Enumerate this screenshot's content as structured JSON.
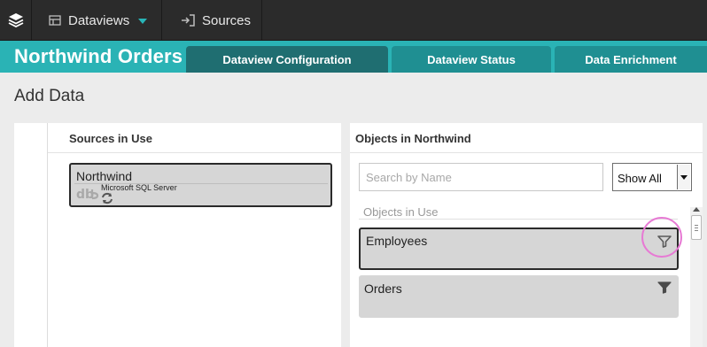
{
  "nav": {
    "logo_icon": "stack-layers-icon",
    "dataviews_label": "Dataviews",
    "dataviews_icon": "dataviews-icon",
    "sources_label": "Sources",
    "sources_icon": "sign-in-icon"
  },
  "header": {
    "title": "Northwind Orders",
    "tabs": [
      {
        "label": "Dataview Configuration",
        "active": true
      },
      {
        "label": "Dataview Status",
        "active": false
      },
      {
        "label": "Data Enrichment",
        "active": false
      }
    ]
  },
  "page": {
    "title": "Add Data"
  },
  "sources_panel": {
    "heading": "Sources in Use",
    "sources": [
      {
        "name": "Northwind",
        "type": "Microsoft SQL Server",
        "icon": "database-icon"
      }
    ]
  },
  "objects_panel": {
    "heading": "Objects in Northwind",
    "search": {
      "placeholder": "Search by Name",
      "value": ""
    },
    "filter_select": {
      "value": "Show All"
    },
    "section_label": "Objects in Use",
    "items": [
      {
        "label": "Employees",
        "selected": true,
        "filter_icon": "filter-outline-icon"
      },
      {
        "label": "Orders",
        "selected": false,
        "filter_icon": "filter-filled-icon"
      }
    ]
  },
  "colors": {
    "accent": "#2ab3b5",
    "tab_active": "#1f6e71",
    "tab_inactive": "#1f8f92",
    "nav_bg": "#2b2b2b",
    "highlight_ring": "#e77ad4"
  }
}
